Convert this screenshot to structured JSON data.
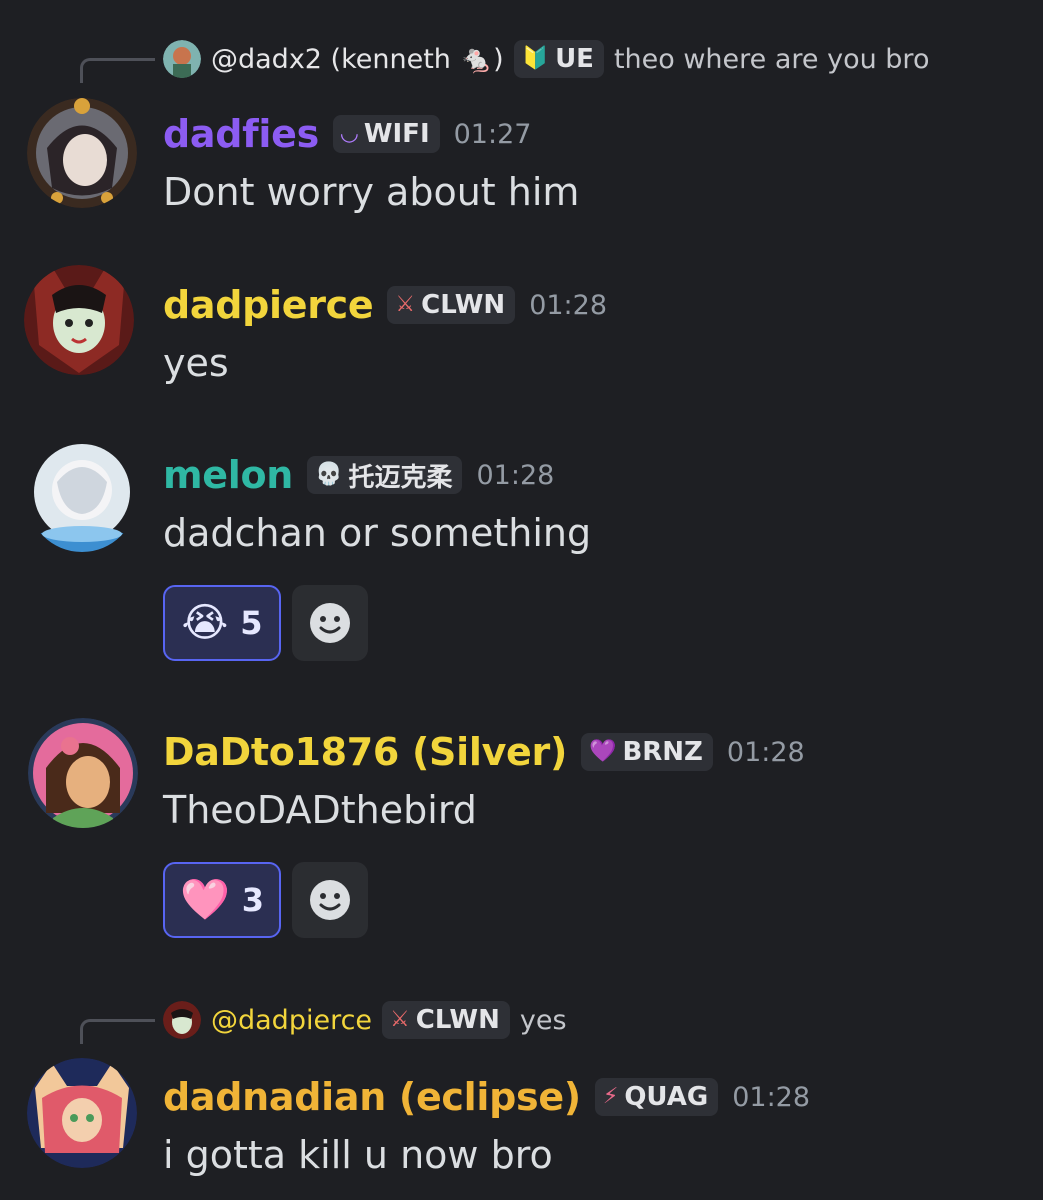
{
  "messages": [
    {
      "reply": {
        "name": "@dadx2 (kenneth 🐁)",
        "tag_icon": "🔰",
        "tag": "UE",
        "text": "theo where are you bro"
      },
      "username": "dadfies",
      "username_color": "#8c5cf2",
      "tag_icon": "◡",
      "tag": "WIFI",
      "time": "01:27",
      "text": "Dont worry about him"
    },
    {
      "username": "dadpierce",
      "username_color": "#f2d53c",
      "tag_icon": "⚔",
      "tag": "CLWN",
      "time": "01:28",
      "text": "yes"
    },
    {
      "username": "melon",
      "username_color": "#2fb8a4",
      "tag_icon": "💀",
      "tag": "托迈克柔",
      "time": "01:28",
      "text": "dadchan or something",
      "reaction": {
        "emoji": "😭",
        "count": "5"
      }
    },
    {
      "username": "DaDto1876 (Silver)",
      "username_color": "#f2d53c",
      "tag_icon": "💜",
      "tag": "BRNZ",
      "time": "01:28",
      "text": "TheoDADthebird",
      "reaction": {
        "emoji": "🩷",
        "count": "3"
      }
    },
    {
      "reply": {
        "name": "@dadpierce",
        "tag_icon": "⚔",
        "tag": "CLWN",
        "text": "yes"
      },
      "username": "dadnadian (eclipse)",
      "username_color": "#f0b437",
      "tag_icon": "⚡",
      "tag": "QUAG",
      "time": "01:28",
      "text": "i gotta kill u now bro"
    }
  ],
  "icons": {
    "add_reaction": "smiley-plus-icon"
  }
}
